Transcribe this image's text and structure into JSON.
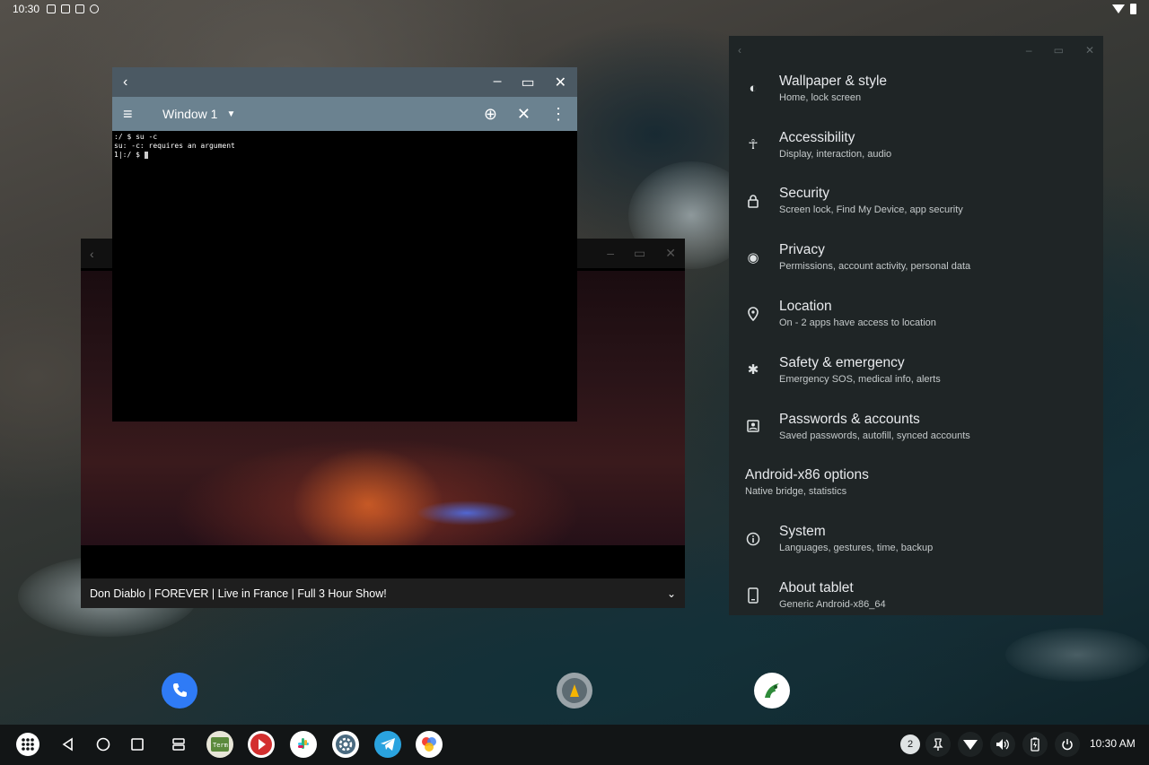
{
  "status_bar": {
    "time": "10:30"
  },
  "terminal": {
    "window_name": "Window 1",
    "lines": [
      ":/ $ su -c",
      "su: -c: requires an argument",
      "1|:/ $ "
    ]
  },
  "video": {
    "caption": "Don Diablo | FOREVER | Live in France | Full 3 Hour Show!"
  },
  "settings": {
    "items": [
      {
        "title": "Wallpaper & style",
        "subtitle": "Home, lock screen",
        "icon": "palette-icon"
      },
      {
        "title": "Accessibility",
        "subtitle": "Display, interaction, audio",
        "icon": "accessibility-icon"
      },
      {
        "title": "Security",
        "subtitle": "Screen lock, Find My Device, app security",
        "icon": "lock-icon"
      },
      {
        "title": "Privacy",
        "subtitle": "Permissions, account activity, personal data",
        "icon": "privacy-eye-icon"
      },
      {
        "title": "Location",
        "subtitle": "On - 2 apps have access to location",
        "icon": "location-pin-icon"
      },
      {
        "title": "Safety & emergency",
        "subtitle": "Emergency SOS, medical info, alerts",
        "icon": "asterisk-icon"
      },
      {
        "title": "Passwords & accounts",
        "subtitle": "Saved passwords, autofill, synced accounts",
        "icon": "account-box-icon"
      },
      {
        "title": "Android-x86 options",
        "subtitle": "Native bridge, statistics",
        "icon": ""
      },
      {
        "title": "System",
        "subtitle": "Languages, gestures, time, backup",
        "icon": "info-icon"
      },
      {
        "title": "About tablet",
        "subtitle": "Generic Android-x86_64",
        "icon": "tablet-icon"
      }
    ]
  },
  "taskbar": {
    "notification_count": "2",
    "clock": "10:30 AM"
  },
  "colors": {
    "settings_bg": "#1f2526",
    "terminal_titlebar": "#4b5963",
    "terminal_toolbar": "#6b8290",
    "taskbar_bg": "#121516",
    "phone_blue": "#2f7bf6"
  }
}
